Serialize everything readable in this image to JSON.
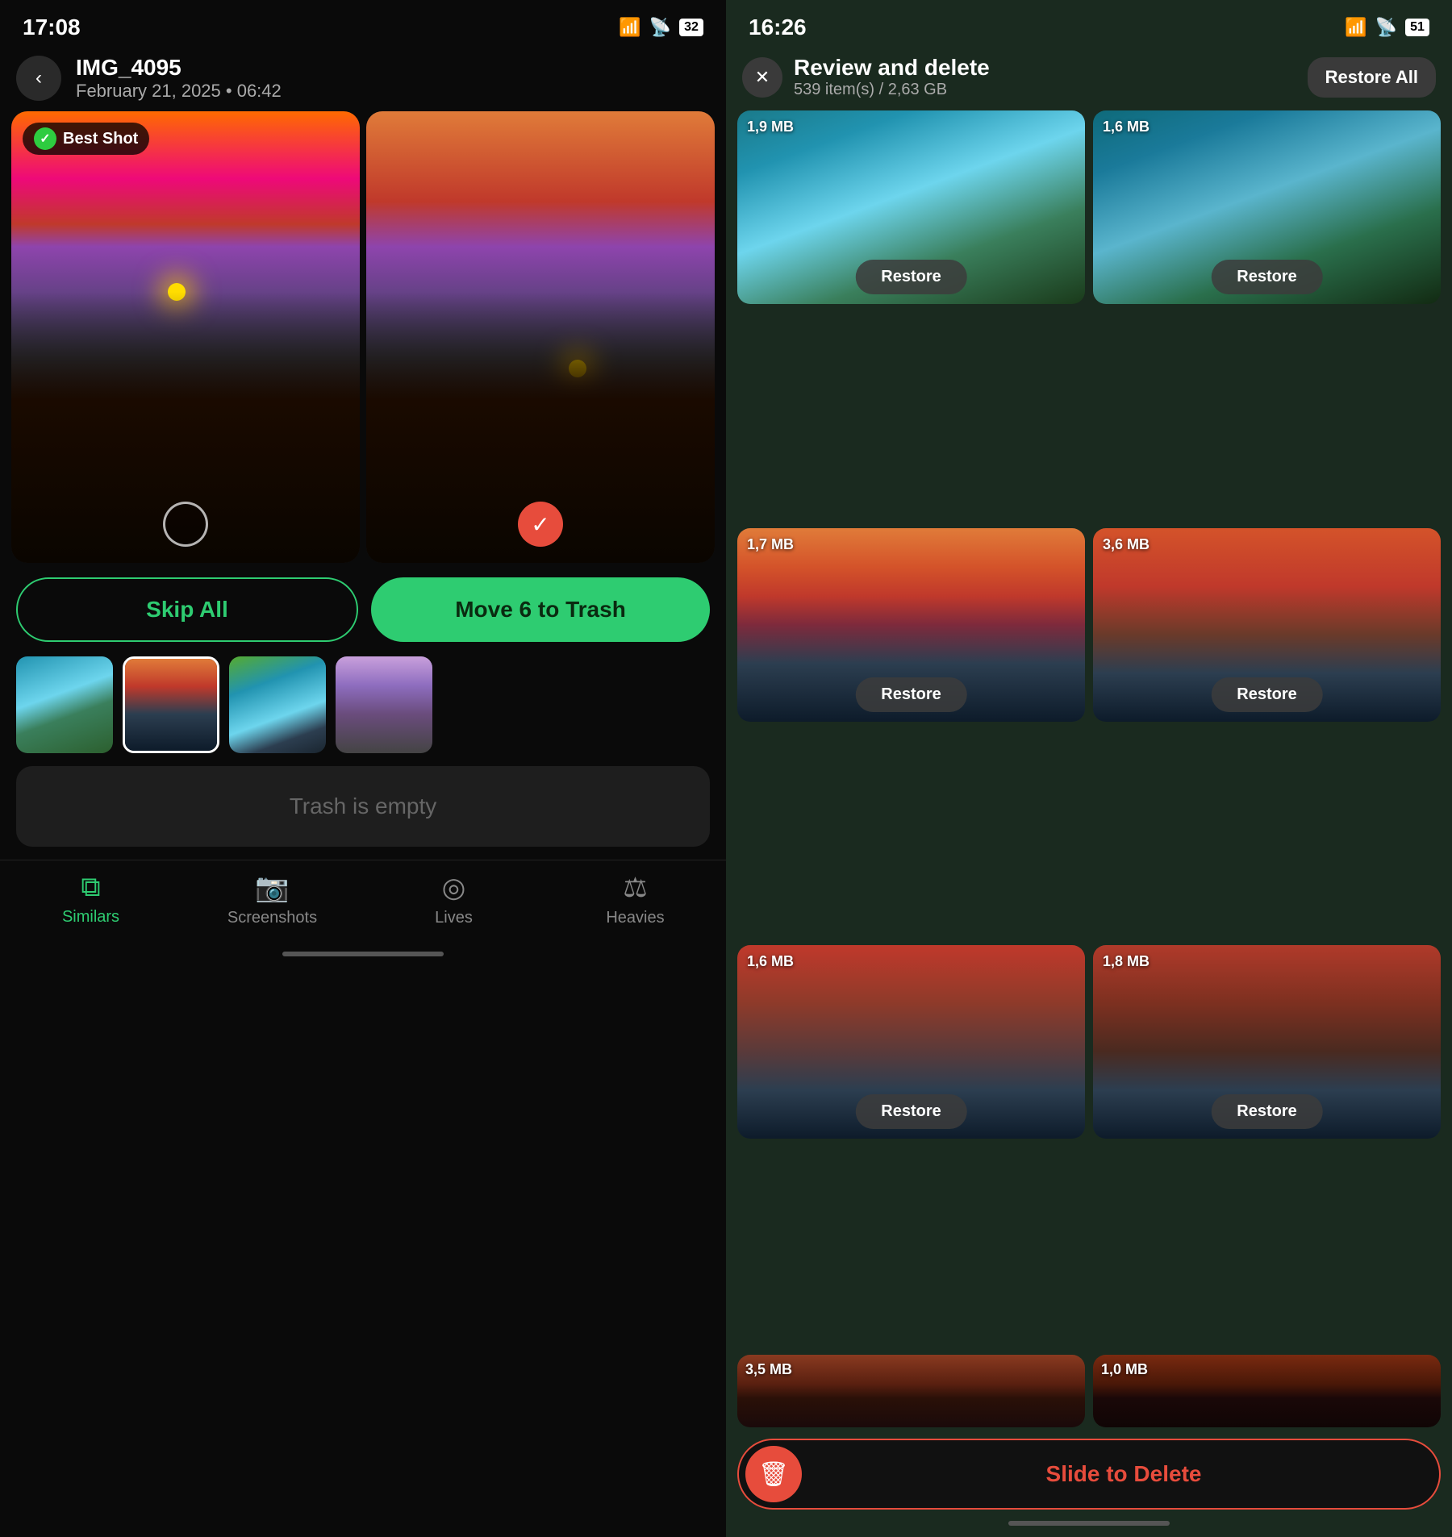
{
  "left": {
    "statusBar": {
      "time": "17:08",
      "battery": "32"
    },
    "header": {
      "backLabel": "‹",
      "imgName": "IMG_4095",
      "imgDate": "February 21, 2025 • 06:42"
    },
    "bestShot": {
      "label": "Best Shot"
    },
    "actions": {
      "skipAll": "Skip All",
      "moveToTrash": "Move 6 to Trash"
    },
    "trashBox": {
      "label": "Trash is empty"
    },
    "bottomNav": {
      "items": [
        {
          "label": "Similars",
          "active": true
        },
        {
          "label": "Screenshots",
          "active": false
        },
        {
          "label": "Lives",
          "active": false
        },
        {
          "label": "Heavies",
          "active": false
        }
      ]
    }
  },
  "right": {
    "statusBar": {
      "time": "16:26",
      "battery": "51"
    },
    "header": {
      "title": "Review and delete",
      "subtitle": "539 item(s) / 2,63 GB",
      "restoreAll": "Restore All"
    },
    "photos": [
      {
        "size": "1,9 MB",
        "restore": "Restore"
      },
      {
        "size": "1,6 MB",
        "restore": "Restore"
      },
      {
        "size": "1,7 MB",
        "restore": "Restore"
      },
      {
        "size": "3,6 MB",
        "restore": "Restore"
      },
      {
        "size": "1,6 MB",
        "restore": "Restore"
      },
      {
        "size": "1,8 MB",
        "restore": "Restore"
      },
      {
        "size": "3,5 MB"
      },
      {
        "size": "1,0 MB"
      }
    ],
    "slideDelete": {
      "label": "Slide to Delete"
    }
  }
}
